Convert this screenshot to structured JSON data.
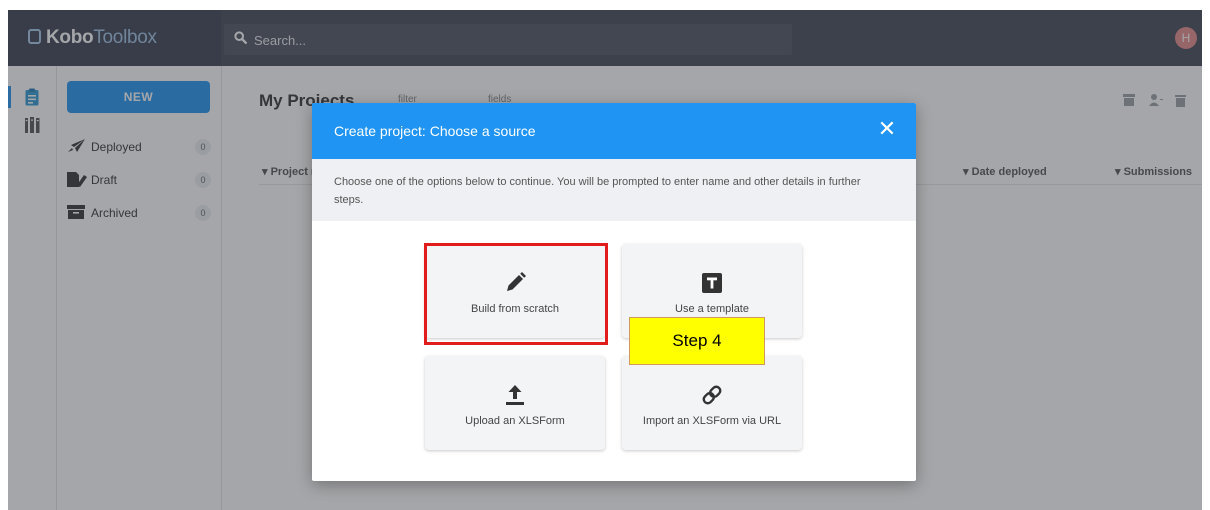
{
  "header": {
    "logo_part1": "Kobo",
    "logo_part2": "Toolbox",
    "search_placeholder": "Search...",
    "avatar_letter": "H"
  },
  "sidebar": {
    "new_button": "NEW",
    "items": [
      {
        "label": "Deployed",
        "count": "0",
        "icon": "rocket-icon"
      },
      {
        "label": "Draft",
        "count": "0",
        "icon": "draft-icon"
      },
      {
        "label": "Archived",
        "count": "0",
        "icon": "archive-icon"
      }
    ]
  },
  "main": {
    "title": "My Projects",
    "filter_label": "filter",
    "fields_label": "fields",
    "columns": [
      "Project n",
      "Date deployed",
      "Submissions"
    ]
  },
  "modal": {
    "title": "Create project: Choose a source",
    "close_symbol": "✕",
    "description": "Choose one of the options below to continue. You will be prompted to enter name and other details in further steps.",
    "options": [
      {
        "label": "Build from scratch",
        "icon": "pencil-icon"
      },
      {
        "label": "Use a template",
        "icon": "template-icon"
      },
      {
        "label": "Upload an XLSForm",
        "icon": "upload-icon"
      },
      {
        "label": "Import an XLSForm via URL",
        "icon": "link-icon"
      }
    ]
  },
  "annotation": {
    "step_label": "Step 4"
  },
  "colors": {
    "accent": "#2094f3",
    "header_bg": "#404756",
    "highlight_border": "#e21b1b",
    "note_bg": "#ffff00"
  }
}
